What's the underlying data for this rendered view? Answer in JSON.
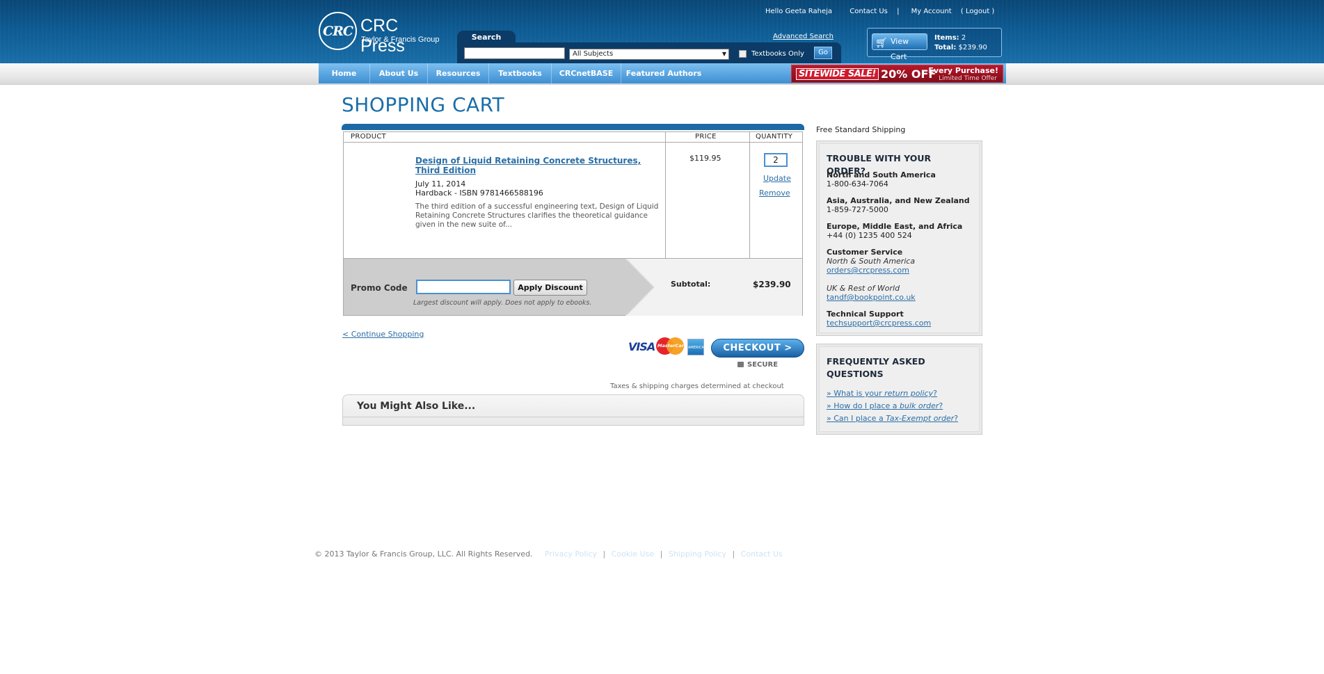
{
  "header": {
    "logo_mark": "CRC",
    "logo_title": "CRC Press",
    "logo_subtitle": "Taylor & Francis Group",
    "greeting": "Hello Geeta Raheja",
    "contact_us": "Contact Us",
    "separator": "|",
    "my_account": "My Account",
    "logout": "( Logout )",
    "search_tab": "Search",
    "search_value": "",
    "subject_select": "All Subjects",
    "textbooks_only": "Textbooks Only",
    "go": "Go",
    "advanced_search": "Advanced Search",
    "view_cart": "View Cart",
    "items_label": "Items:",
    "items_count": "2",
    "total_label": "Total:",
    "total_value": "$239.90"
  },
  "nav": {
    "items": [
      "Home",
      "About Us",
      "Resources",
      "Textbooks",
      "CRCnetBASE",
      "Featured Authors"
    ],
    "sale_tag": "SITEWIDE SALE!",
    "sale_off": "20% OFF",
    "sale_every": "Every Purchase!",
    "sale_limited": "Limited Time Offer"
  },
  "page_title": "SHOPPING CART",
  "cart": {
    "headers": {
      "product": "PRODUCT",
      "price": "PRICE",
      "quantity": "QUANTITY"
    },
    "item": {
      "title": "Design of Liquid Retaining Concrete Structures, Third Edition",
      "date": "July 11, 2014",
      "format_isbn": "Hardback - ISBN 9781466588196",
      "description": "The third edition of a successful engineering text, Design of Liquid Retaining Concrete Structures clarifies the theoretical guidance given in the new suite of...",
      "price": "$119.95",
      "quantity": "2",
      "update": "Update",
      "remove": "Remove"
    },
    "promo_label": "Promo Code",
    "promo_value": "",
    "apply_discount": "Apply Discount",
    "promo_note": "Largest discount will apply. Does not apply to ebooks.",
    "subtotal_label": "Subtotal:",
    "subtotal_value": "$239.90"
  },
  "continue_shopping": "< Continue Shopping",
  "payment": {
    "visa": "VISA",
    "mastercard": "MasterCard",
    "amex": "AMERICAN EXPRESS",
    "checkout": "CHECKOUT >",
    "secure": "SECURE"
  },
  "tax_note": "Taxes & shipping charges determined at checkout",
  "also_like_title": "You Might Also Like...",
  "sidebar": {
    "free_shipping": "Free Standard Shipping",
    "trouble_title": "TROUBLE WITH YOUR ORDER?",
    "region_1": "North and South America",
    "phone_1": "1-800-634-7064",
    "region_2": "Asia, Australia, and New Zealand",
    "phone_2": "1-859-727-5000",
    "region_3": "Europe, Middle East, and Africa",
    "phone_3": "+44 (0) 1235 400 524",
    "customer_service": "Customer Service",
    "cs_na": "North & South America",
    "cs_na_email": "orders@crcpress.com",
    "cs_uk": "UK & Rest of World",
    "cs_uk_email": "tandf@bookpoint.co.uk",
    "tech_support": "Technical Support",
    "tech_email": "techsupport@crcpress.com",
    "faq_title": "FREQUENTLY ASKED QUESTIONS",
    "faq_1_prefix": "» What is your ",
    "faq_1_em": "return policy",
    "faq_1_suffix": "?",
    "faq_2_prefix": "» How do I place a ",
    "faq_2_em": "bulk order",
    "faq_2_suffix": "?",
    "faq_3_prefix": "» Can I place a ",
    "faq_3_em": "Tax-Exempt order",
    "faq_3_suffix": "?"
  },
  "footer": {
    "copyright": "© 2013 Taylor & Francis Group, LLC. All Rights Reserved.",
    "links": [
      "Privacy Policy",
      "Cookie Use",
      "Shipping Policy",
      "Contact Us"
    ],
    "sep": "|"
  }
}
